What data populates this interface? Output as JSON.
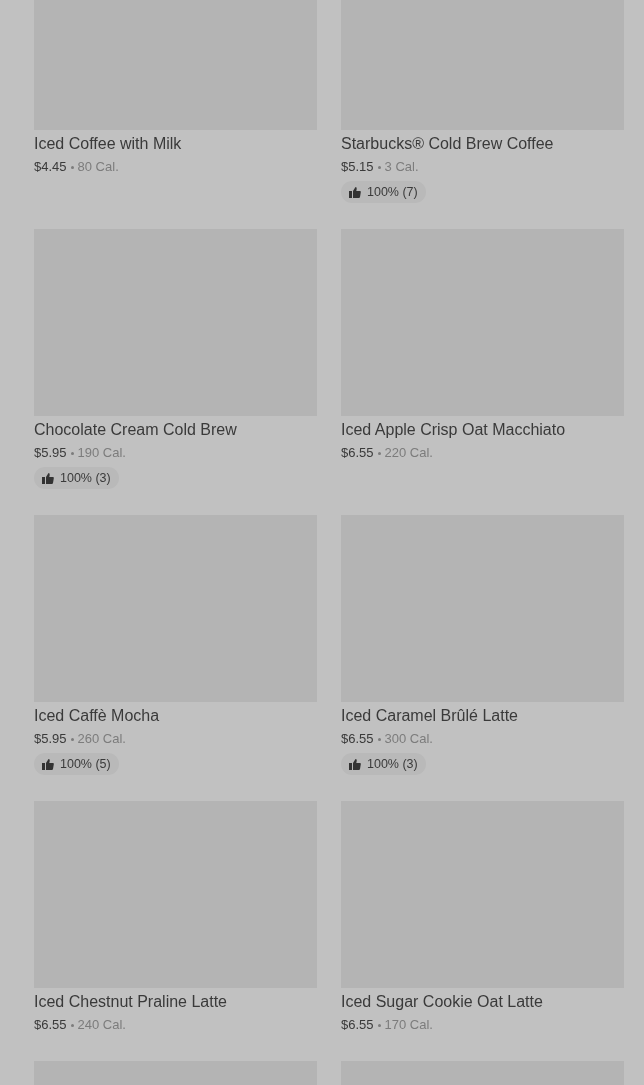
{
  "items": [
    {
      "name": "Iced Coffee with Milk",
      "price": "$4.45",
      "calories": "80 Cal."
    },
    {
      "name": "Starbucks® Cold Brew Coffee",
      "price": "$5.15",
      "calories": "3 Cal.",
      "rating": "100% (7)"
    },
    {
      "name": "Chocolate Cream Cold Brew",
      "price": "$5.95",
      "calories": "190 Cal.",
      "rating": "100% (3)"
    },
    {
      "name": "Iced Apple Crisp Oat Macchiato",
      "price": "$6.55",
      "calories": "220 Cal."
    },
    {
      "name": "Iced Caffè Mocha",
      "price": "$5.95",
      "calories": "260 Cal.",
      "rating": "100% (5)"
    },
    {
      "name": "Iced Caramel Brûlé Latte",
      "price": "$6.55",
      "calories": "300 Cal.",
      "rating": "100% (3)"
    },
    {
      "name": "Iced Chestnut Praline Latte",
      "price": "$6.55",
      "calories": "240 Cal."
    },
    {
      "name": "Iced Sugar Cookie Oat Latte",
      "price": "$6.55",
      "calories": "170 Cal."
    }
  ]
}
